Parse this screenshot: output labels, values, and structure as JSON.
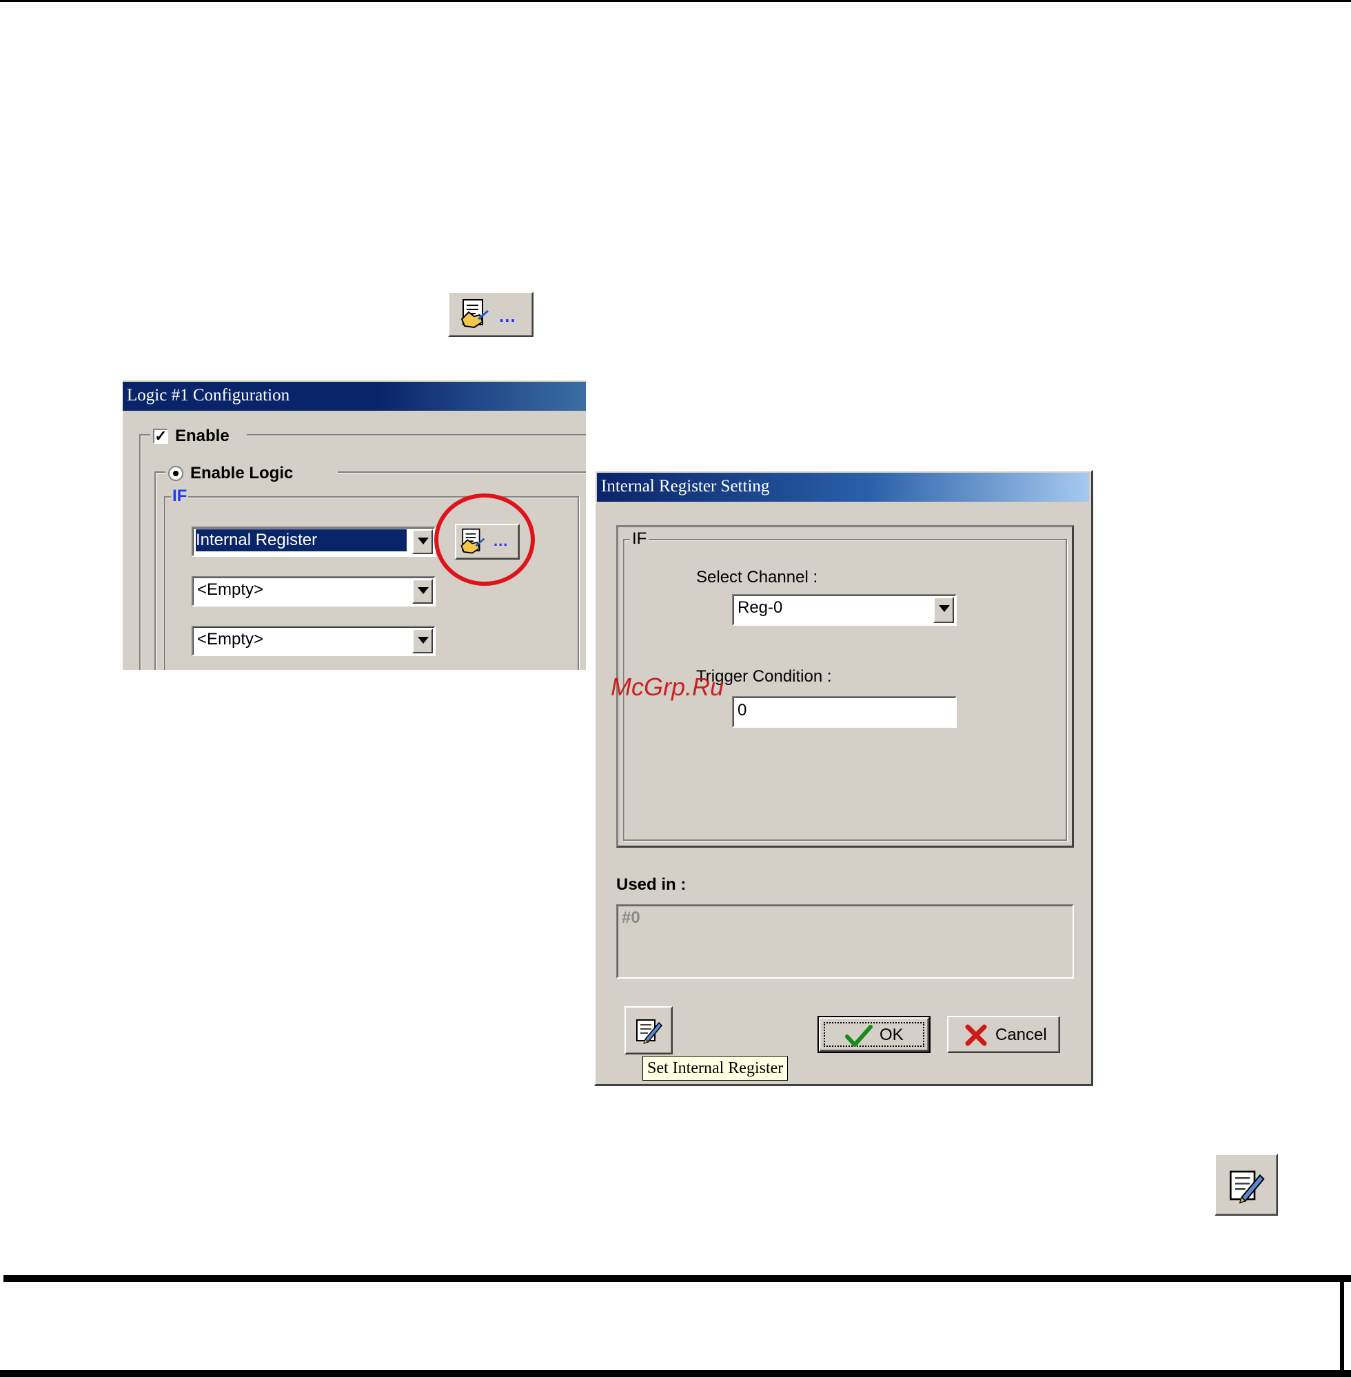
{
  "toolbar_icon": {
    "icon": "document-hand-icon",
    "dots": "..."
  },
  "logic_window": {
    "title": "Logic #1 Configuration",
    "enable_label": "Enable",
    "enable_logic_label": "Enable Logic",
    "if_label": "IF",
    "condition1": {
      "value": "Internal Register"
    },
    "condition2": {
      "value": "<Empty>"
    },
    "condition3": {
      "value": "<Empty>"
    },
    "settings_button": {
      "icon": "document-hand-icon",
      "dots": "..."
    },
    "highlight_color": "#e0121a"
  },
  "register_dialog": {
    "title": "Internal Register Setting",
    "if_label": "IF",
    "select_channel_label": "Select Channel :",
    "select_channel_value": "Reg-0",
    "trigger_condition_label": "Trigger Condition :",
    "trigger_condition_value": "0",
    "used_in_label": "Used in :",
    "used_in_value": "#0",
    "ok_label": "OK",
    "cancel_label": "Cancel",
    "tooltip": "Set Internal Register",
    "edit_icon": "notepad-pencil-icon"
  },
  "watermark": "McGrp.Ru",
  "standalone_edit_icon": "notepad-pencil-icon"
}
